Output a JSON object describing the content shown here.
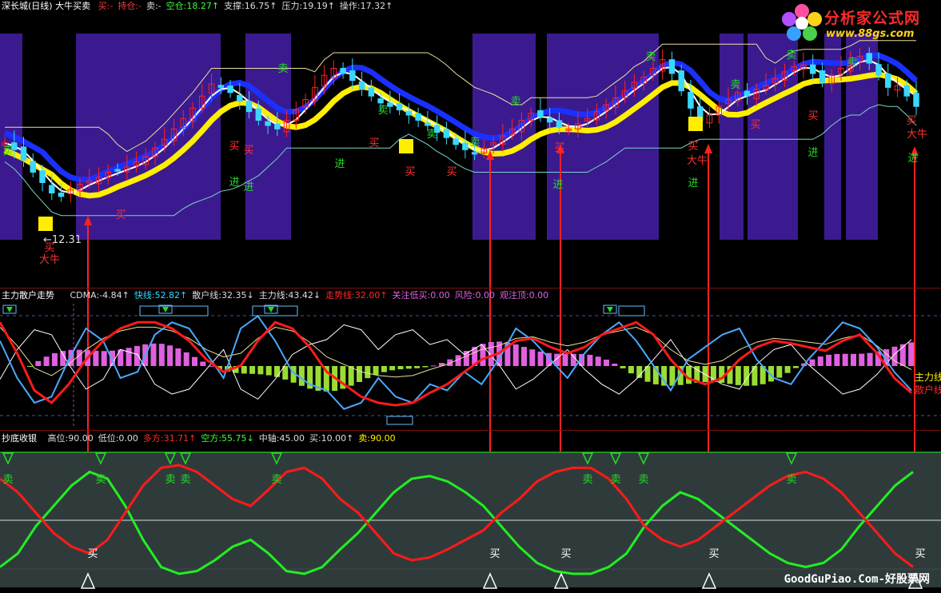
{
  "header": {
    "title": "深长城(日线) 大牛买卖",
    "items": [
      {
        "label": "买:",
        "value": "-",
        "color": "#ff3b3b"
      },
      {
        "label": "持仓:",
        "value": "-",
        "color": "#ff3b3b"
      },
      {
        "label": "卖:",
        "value": "-",
        "color": "#dddddd"
      },
      {
        "label": "空仓:",
        "value": "18.27↑",
        "color": "#3cff3c"
      },
      {
        "label": "支撑:",
        "value": "16.75↑",
        "color": "#dddddd"
      },
      {
        "label": "压力:",
        "value": "19.19↑",
        "color": "#dddddd"
      },
      {
        "label": "操作:",
        "value": "17.32↑",
        "color": "#dddddd"
      }
    ]
  },
  "logo": {
    "title": "分析家公式网",
    "url": "www.88gs.com"
  },
  "watermark": "GoodGuPiao.Com-好股票网",
  "colors": {
    "band": "#3b1a8f",
    "up": "#ff2020",
    "down": "#3ad7ff",
    "yellow": "#ffee00",
    "blue": "#1a30ff",
    "green": "#22dd22",
    "red": "#ff1a1a",
    "white": "#ffffff",
    "cyan": "#34d6ff",
    "magenta": "#e060e0"
  },
  "panel1": {
    "annotations": [
      {
        "t": "卖",
        "x": 10,
        "y": 193,
        "c": "#22dd22"
      },
      {
        "t": "买",
        "x": 62,
        "y": 314,
        "c": "#ff3030"
      },
      {
        "t": "大牛",
        "x": 62,
        "y": 329,
        "c": "#ff3030"
      },
      {
        "t": "买",
        "x": 151,
        "y": 273,
        "c": "#ff3030"
      },
      {
        "t": "进",
        "x": 293,
        "y": 232,
        "c": "#22dd22"
      },
      {
        "t": "进",
        "x": 311,
        "y": 238,
        "c": "#22dd22"
      },
      {
        "t": "买",
        "x": 293,
        "y": 187,
        "c": "#ff3030"
      },
      {
        "t": "买",
        "x": 311,
        "y": 192,
        "c": "#ff3030"
      },
      {
        "t": "卖",
        "x": 354,
        "y": 90,
        "c": "#22dd22"
      },
      {
        "t": "进",
        "x": 425,
        "y": 209,
        "c": "#22dd22"
      },
      {
        "t": "卖",
        "x": 479,
        "y": 142,
        "c": "#22dd22"
      },
      {
        "t": "买",
        "x": 468,
        "y": 183,
        "c": "#ff3030"
      },
      {
        "t": "买",
        "x": 513,
        "y": 219,
        "c": "#ff3030"
      },
      {
        "t": "卖",
        "x": 540,
        "y": 172,
        "c": "#22dd22"
      },
      {
        "t": "买",
        "x": 565,
        "y": 219,
        "c": "#ff3030"
      },
      {
        "t": "卖",
        "x": 594,
        "y": 182,
        "c": "#22dd22"
      },
      {
        "t": "卖",
        "x": 645,
        "y": 131,
        "c": "#22dd22"
      },
      {
        "t": "进",
        "x": 698,
        "y": 235,
        "c": "#22dd22"
      },
      {
        "t": "买",
        "x": 700,
        "y": 189,
        "c": "#ff3030"
      },
      {
        "t": "卖",
        "x": 814,
        "y": 75,
        "c": "#22dd22"
      },
      {
        "t": "买",
        "x": 867,
        "y": 187,
        "c": "#ff3030"
      },
      {
        "t": "大牛",
        "x": 872,
        "y": 205,
        "c": "#ff3030"
      },
      {
        "t": "进",
        "x": 867,
        "y": 233,
        "c": "#22dd22"
      },
      {
        "t": "卖",
        "x": 920,
        "y": 110,
        "c": "#22dd22"
      },
      {
        "t": "买",
        "x": 945,
        "y": 160,
        "c": "#ff3030"
      },
      {
        "t": "卖",
        "x": 990,
        "y": 73,
        "c": "#22dd22"
      },
      {
        "t": "买",
        "x": 1017,
        "y": 149,
        "c": "#ff3030"
      },
      {
        "t": "进",
        "x": 1017,
        "y": 195,
        "c": "#22dd22"
      },
      {
        "t": "卖",
        "x": 1066,
        "y": 82,
        "c": "#22dd22"
      },
      {
        "t": "买",
        "x": 1140,
        "y": 155,
        "c": "#ff3030"
      },
      {
        "t": "大牛",
        "x": 1147,
        "y": 172,
        "c": "#ff3030"
      },
      {
        "t": "进",
        "x": 1142,
        "y": 202,
        "c": "#22dd22"
      },
      {
        "t": "←12.31",
        "x": 78,
        "y": 304,
        "c": "#dddddd"
      }
    ]
  },
  "panel2": {
    "title": "主力散户走势",
    "items": [
      {
        "label": "CDMA:",
        "value": "-4.84↑",
        "color": "#dddddd"
      },
      {
        "label": "快线:",
        "value": "52.82↑",
        "color": "#34d6ff"
      },
      {
        "label": "散户线:",
        "value": "32.35↓",
        "color": "#dddddd"
      },
      {
        "label": "主力线:",
        "value": "43.42↓",
        "color": "#dddddd"
      },
      {
        "label": "走势线:",
        "value": "32.00↑",
        "color": "#ff2a2a"
      },
      {
        "label": "关注低买:",
        "value": "0.00",
        "color": "#e060e0"
      },
      {
        "label": "风险:",
        "value": "0.00",
        "color": "#e060e0"
      },
      {
        "label": "观注顶:",
        "value": "0.00",
        "color": "#e060e0"
      }
    ],
    "right_labels": [
      {
        "t": "主力线",
        "c": "#ffee00"
      },
      {
        "t": "散户线",
        "c": "#ff2a2a"
      }
    ]
  },
  "panel3": {
    "title": "抄底收银",
    "items": [
      {
        "label": "高位:",
        "value": "90.00",
        "color": "#dddddd"
      },
      {
        "label": "低位:",
        "value": "0.00",
        "color": "#dddddd"
      },
      {
        "label": "多方:",
        "value": "31.71↑",
        "color": "#ff2a2a"
      },
      {
        "label": "空方:",
        "value": "55.75↓",
        "color": "#3cff3c"
      },
      {
        "label": "中轴:",
        "value": "45.00",
        "color": "#dddddd"
      },
      {
        "label": "买:",
        "value": "10.00↑",
        "color": "#dddddd"
      },
      {
        "label": "卖:",
        "value": "90.00",
        "color": "#ffee00"
      }
    ],
    "sell_marks": [
      {
        "t": "卖",
        "x": 10
      },
      {
        "t": "卖",
        "x": 126
      },
      {
        "t": "卖",
        "x": 213
      },
      {
        "t": "卖",
        "x": 232
      },
      {
        "t": "卖",
        "x": 346
      },
      {
        "t": "卖",
        "x": 735
      },
      {
        "t": "卖",
        "x": 770
      },
      {
        "t": "卖",
        "x": 805
      },
      {
        "t": "卖",
        "x": 990
      }
    ],
    "buy_marks": [
      {
        "t": "买",
        "x": 116
      },
      {
        "t": "买",
        "x": 619
      },
      {
        "t": "买",
        "x": 708
      },
      {
        "t": "买",
        "x": 893
      },
      {
        "t": "买",
        "x": 1151
      }
    ]
  },
  "chart_data": [
    {
      "type": "candlestick",
      "title": "",
      "series": [
        {
          "name": "candles",
          "values": [
            19.6,
            19.2,
            18.6,
            17.9,
            17.3,
            16.7,
            16.5,
            16.9,
            17.2,
            17.4,
            17.6,
            17.9,
            18.0,
            18.2,
            18.5,
            18.8,
            19.3,
            19.8,
            20.4,
            21.0,
            21.6,
            22.3,
            23.0,
            22.8,
            22.5,
            22.0,
            21.4,
            20.9,
            20.6,
            20.4,
            20.9,
            21.5,
            22.1,
            22.8,
            23.5,
            23.9,
            23.6,
            23.2,
            22.7,
            22.3,
            21.9,
            21.7,
            21.5,
            21.2,
            20.9,
            20.6,
            20.2,
            19.9,
            19.5,
            19.2,
            19.0,
            19.3,
            19.6,
            20.0,
            20.4,
            20.9,
            21.3,
            21.1,
            20.8,
            20.5,
            20.4,
            20.7,
            21.0,
            21.4,
            21.8,
            22.2,
            22.6,
            23.1,
            23.4,
            23.9,
            24.4,
            23.6,
            22.6,
            21.6,
            20.9,
            21.2,
            21.7,
            22.1,
            22.5,
            22.3,
            22.7,
            22.9,
            23.3,
            23.7,
            24.0,
            24.1,
            23.6,
            23.1,
            23.5,
            23.9,
            24.3,
            24.6,
            24.2,
            23.5,
            22.8,
            22.9,
            22.3,
            21.7
          ]
        }
      ],
      "ylim": [
        14,
        26
      ]
    },
    {
      "type": "line",
      "title": "",
      "series": [
        {
          "name": "快线",
          "values": [
            70,
            40,
            20,
            25,
            55,
            80,
            70,
            40,
            45,
            75,
            85,
            80,
            60,
            40,
            80,
            90,
            70,
            45,
            35,
            30,
            15,
            20,
            40,
            25,
            20,
            35,
            30,
            45,
            35,
            55,
            80,
            70,
            55,
            40,
            60,
            75,
            85,
            70,
            50,
            30,
            55,
            65,
            75,
            80,
            55,
            40,
            35,
            55,
            70,
            85,
            80,
            65,
            45,
            30
          ]
        },
        {
          "name": "走势线",
          "values": [
            85,
            60,
            30,
            20,
            35,
            55,
            70,
            80,
            85,
            85,
            80,
            70,
            55,
            45,
            50,
            70,
            85,
            80,
            65,
            45,
            35,
            25,
            20,
            18,
            20,
            28,
            35,
            45,
            55,
            60,
            70,
            72,
            65,
            60,
            65,
            75,
            80,
            85,
            75,
            55,
            40,
            35,
            40,
            55,
            65,
            70,
            68,
            65,
            62,
            70,
            75,
            60,
            40,
            28
          ]
        }
      ],
      "ylim": [
        0,
        100
      ]
    },
    {
      "type": "line",
      "title": "",
      "series": [
        {
          "name": "多方",
          "values": [
            80,
            70,
            55,
            40,
            30,
            25,
            35,
            55,
            75,
            88,
            90,
            85,
            75,
            65,
            60,
            72,
            85,
            88,
            80,
            65,
            55,
            40,
            25,
            20,
            22,
            28,
            35,
            42,
            55,
            65,
            78,
            85,
            88,
            88,
            80,
            65,
            45,
            35,
            30,
            35,
            45,
            55,
            65,
            75,
            82,
            85,
            80,
            70,
            55,
            40,
            25,
            15
          ]
        },
        {
          "name": "空方",
          "values": [
            15,
            25,
            45,
            60,
            75,
            85,
            80,
            60,
            35,
            15,
            10,
            12,
            20,
            30,
            35,
            25,
            12,
            10,
            15,
            28,
            40,
            55,
            70,
            80,
            82,
            78,
            70,
            60,
            45,
            30,
            18,
            12,
            10,
            10,
            15,
            25,
            45,
            60,
            70,
            65,
            55,
            45,
            35,
            25,
            18,
            15,
            18,
            28,
            45,
            60,
            75,
            85
          ]
        }
      ],
      "ylim": [
        0,
        100
      ]
    }
  ]
}
